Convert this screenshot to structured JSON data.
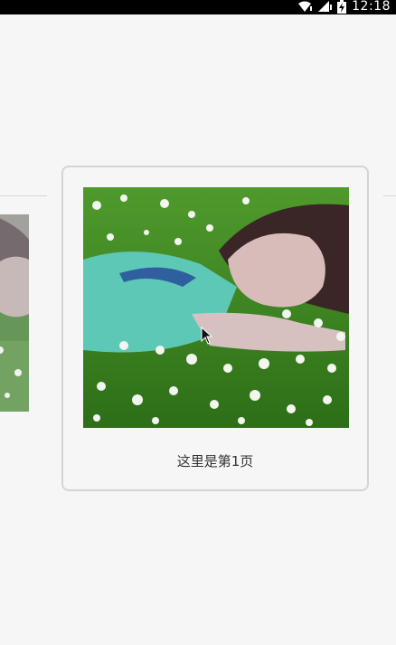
{
  "status_bar": {
    "time": "12:18",
    "icons": [
      "wifi-icon",
      "signal-icon",
      "battery-charging-icon"
    ]
  },
  "pager": {
    "current_page": {
      "caption": "这里是第1页"
    }
  },
  "colors": {
    "background": "#f6f6f6",
    "card_border": "#d4d4d4",
    "status_bar": "#000000"
  }
}
